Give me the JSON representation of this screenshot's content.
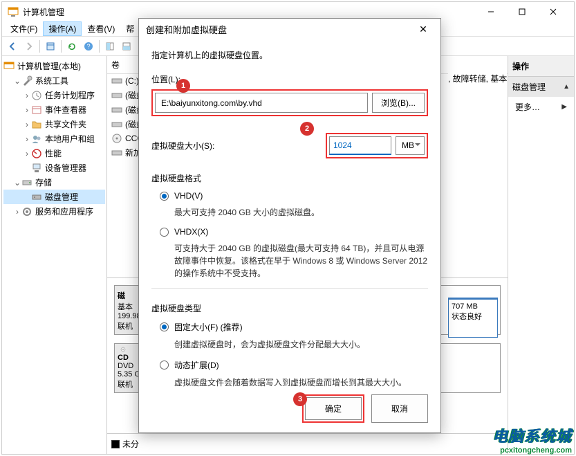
{
  "window": {
    "title": "计算机管理"
  },
  "menu": {
    "file": "文件(F)",
    "action": "操作(A)",
    "view": "查看(V)",
    "help": "帮"
  },
  "tree": {
    "root": "计算机管理(本地)",
    "systools": "系统工具",
    "task": "任务计划程序",
    "event": "事件查看器",
    "shared": "共享文件夹",
    "users": "本地用户和组",
    "perf": "性能",
    "devmgr": "设备管理器",
    "storage": "存储",
    "diskmgmt": "磁盘管理",
    "services": "服务和应用程序"
  },
  "vol": {
    "col": "卷",
    "c": "(C:)",
    "d1": "(磁盘",
    "d2": "(磁盘",
    "d3": "(磁盘",
    "ccc": "CCC(",
    "new": "新加"
  },
  "disk0": {
    "name": "磁",
    "type": "基本",
    "size": "199.98",
    "status": "联机"
  },
  "disk_cd": {
    "name": "CD",
    "type": "DVD",
    "size": "5.35 G",
    "status": "联机"
  },
  "part": {
    "size": "707 MB",
    "status": "状态良好"
  },
  "legend": {
    "unalloc": "未分"
  },
  "actions": {
    "title": "操作",
    "sub": "磁盘管理",
    "more": "更多…"
  },
  "extra_right": ", 故障转储, 基本",
  "dialog": {
    "title": "创建和附加虚拟硬盘",
    "instr": "指定计算机上的虚拟硬盘位置。",
    "loc_label": "位置(L):",
    "loc_value": "E:\\baiyunxitong.com\\by.vhd",
    "browse": "浏览(B)...",
    "size_label": "虚拟硬盘大小(S):",
    "size_value": "1024",
    "size_unit": "MB",
    "fmt_title": "虚拟硬盘格式",
    "vhd": "VHD(V)",
    "vhd_desc": "最大可支持 2040 GB 大小的虚拟磁盘。",
    "vhdx": "VHDX(X)",
    "vhdx_desc": "可支持大于 2040 GB 的虚拟磁盘(最大可支持 64 TB)，并且可从电源故障事件中恢复。该格式在早于 Windows 8 或 Windows Server 2012 的操作系统中不受支持。",
    "type_title": "虚拟硬盘类型",
    "fixed": "固定大小(F) (推荐)",
    "fixed_desc": "创建虚拟硬盘时，会为虚拟硬盘文件分配最大大小。",
    "dynamic": "动态扩展(D)",
    "dynamic_desc": "虚拟硬盘文件会随着数据写入到虚拟硬盘而增长到其最大大小。",
    "ok": "确定",
    "cancel": "取消"
  },
  "callouts": {
    "c1": "1",
    "c2": "2",
    "c3": "3"
  },
  "watermark": {
    "cn": "电脑系统城",
    "url": "pcxitongcheng.com"
  }
}
